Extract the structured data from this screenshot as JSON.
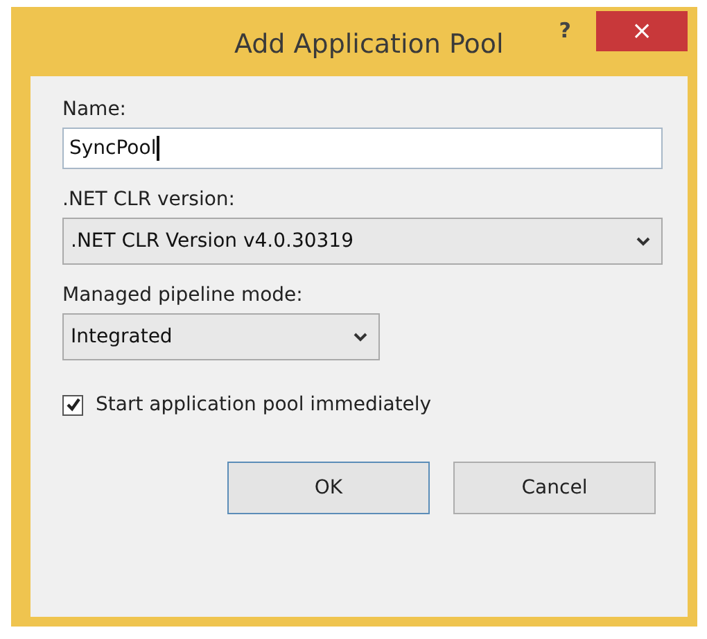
{
  "window": {
    "title": "Add Application Pool",
    "help": "?",
    "close": "×"
  },
  "name_field": {
    "label": "Name:",
    "value": "SyncPool"
  },
  "clr_select": {
    "label": ".NET CLR version:",
    "value": ".NET CLR Version v4.0.30319"
  },
  "pipeline_select": {
    "label": "Managed pipeline mode:",
    "value": "Integrated"
  },
  "start_checkbox": {
    "label": "Start application pool immediately",
    "checked": true
  },
  "buttons": [
    {
      "label": "OK",
      "kind": "default"
    },
    {
      "label": "Cancel",
      "kind": "normal"
    }
  ]
}
